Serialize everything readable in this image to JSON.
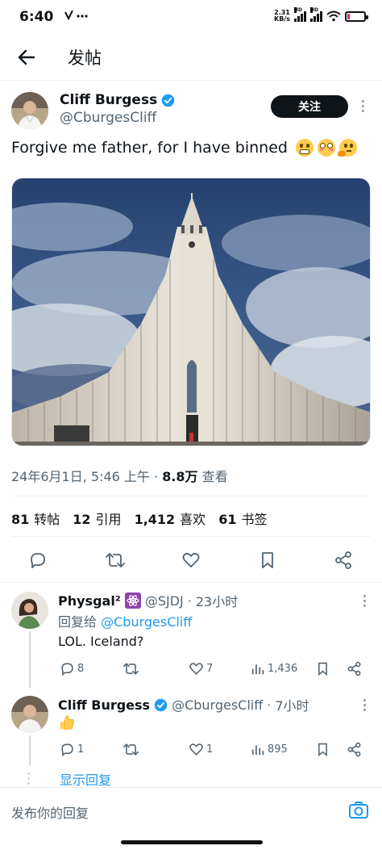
{
  "status_bar": {
    "time": "6:40",
    "net_speed_value": "2.31",
    "net_speed_unit": "KB/s",
    "signal_label_1": "HD",
    "signal_label_2": "HD",
    "battery_level": 0.12,
    "battery_color": "#e0245e"
  },
  "header": {
    "title": "发帖",
    "back_icon": "arrow-left-icon"
  },
  "tweet": {
    "author_name": "Cliff Burgess",
    "author_handle": "@CburgesCliff",
    "verified": true,
    "follow_label": "关注",
    "text": "Forgive me father, for I have binned",
    "emojis": [
      "grimacing-face",
      "flushed-face",
      "thinking-face"
    ],
    "timestamp": "24年6月1日, 5:46 上午",
    "separator": "·",
    "views_count": "8.8万",
    "views_label": "查看",
    "stats": [
      {
        "count": "81",
        "label": "转帖"
      },
      {
        "count": "12",
        "label": "引用"
      },
      {
        "count": "1,412",
        "label": "喜欢"
      },
      {
        "count": "61",
        "label": "书签"
      }
    ],
    "actions": [
      "reply-icon",
      "retweet-icon",
      "like-icon",
      "bookmark-icon",
      "share-icon"
    ]
  },
  "replies": [
    {
      "name": "Physgal²",
      "badge_icon": "atom-icon",
      "handle": "@SJDJ",
      "separator": "·",
      "time": "23小时",
      "reply_to_prefix": "回复给",
      "reply_to_handle": "@CburgesCliff",
      "text": "LOL. Iceland?",
      "reply_count": "8",
      "retweet_count": "",
      "like_count": "7",
      "view_count": "1,436"
    },
    {
      "name": "Cliff Burgess",
      "verified": true,
      "handle": "@CburgesCliff",
      "separator": "·",
      "time": "7小时",
      "text_emoji": "thumbs-up",
      "reply_count": "1",
      "retweet_count": "",
      "like_count": "1",
      "view_count": "895"
    }
  ],
  "show_replies_label": "显示回复",
  "compose": {
    "placeholder": "发布你的回复",
    "camera_icon": "camera-icon"
  },
  "colors": {
    "accent": "#1d9bf0",
    "text": "#0f1419",
    "secondary": "#536471"
  }
}
